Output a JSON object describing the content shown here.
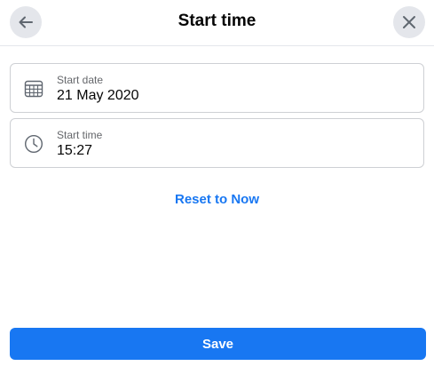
{
  "header": {
    "title": "Start time",
    "back_icon": "arrow-left-icon",
    "close_icon": "close-icon"
  },
  "fields": {
    "date": {
      "label": "Start date",
      "value": "21 May 2020",
      "icon": "calendar-icon"
    },
    "time": {
      "label": "Start time",
      "value": "15:27",
      "icon": "clock-icon"
    }
  },
  "reset": {
    "label": "Reset to Now"
  },
  "save": {
    "label": "Save"
  },
  "colors": {
    "accent": "#1877f2",
    "circle_button_bg": "#e4e6eb",
    "border": "#ced0d4",
    "secondary_text": "#65676b"
  }
}
